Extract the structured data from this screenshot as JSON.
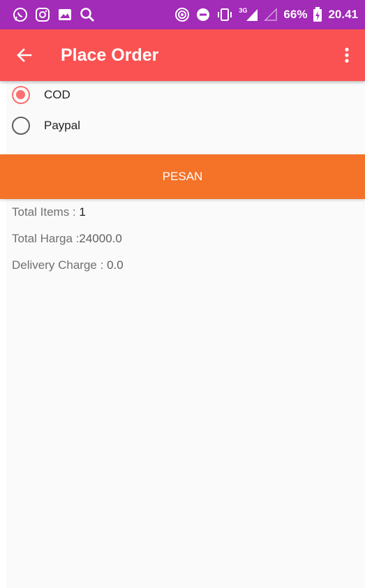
{
  "status_bar": {
    "battery_percent": "66%",
    "network_type": "3G",
    "time": "20.41",
    "icons": [
      "whatsapp-icon",
      "instagram-icon",
      "gallery-icon",
      "search-icon",
      "hotspot-icon",
      "do-not-disturb-icon",
      "vibrate-icon",
      "signal-icon",
      "no-signal-icon",
      "battery-icon"
    ]
  },
  "app_bar": {
    "title": "Place Order",
    "back_icon": "arrow-left-icon",
    "menu_icon": "more-vert-icon"
  },
  "payment_options": [
    {
      "label": "COD",
      "selected": true
    },
    {
      "label": "Paypal",
      "selected": false
    }
  ],
  "order_button": {
    "label": "PESAN"
  },
  "summary": {
    "total_items_label": "Total Items : ",
    "total_items_value": "1",
    "total_harga_label": "Total Harga :",
    "total_harga_value": "24000.0",
    "delivery_label": "Delivery Charge : ",
    "delivery_value": " 0.0"
  },
  "colors": {
    "status_bar": "#a22bb8",
    "app_bar": "#fa5252",
    "radio_accent": "#fa7070",
    "button": "#f47329",
    "background": "#fafafa"
  }
}
